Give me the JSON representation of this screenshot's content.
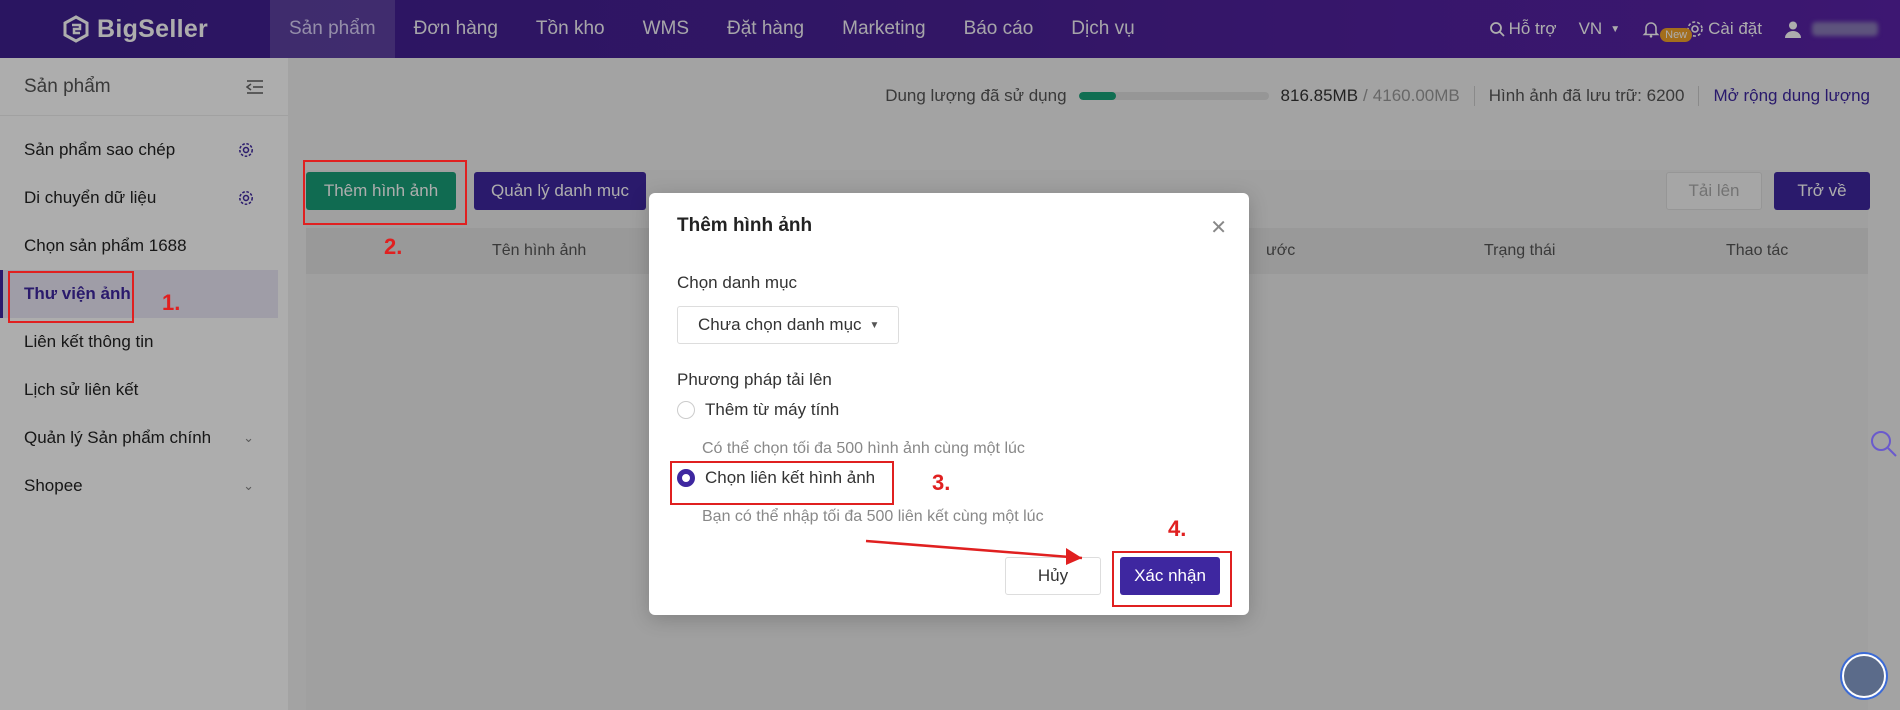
{
  "brand": {
    "name": "BigSeller"
  },
  "nav": {
    "items": [
      "Sản phẩm",
      "Đơn hàng",
      "Tồn kho",
      "WMS",
      "Đặt hàng",
      "Marketing",
      "Báo cáo",
      "Dịch vụ"
    ],
    "support": "Hỗ trợ",
    "lang": "VN",
    "new_badge": "New",
    "settings": "Cài đặt"
  },
  "sidebar": {
    "title": "Sản phẩm",
    "items": [
      {
        "label": "Sản phẩm sao chép"
      },
      {
        "label": "Di chuyển dữ liệu"
      },
      {
        "label": "Chọn sản phẩm 1688"
      },
      {
        "label": "Thư viện ảnh"
      },
      {
        "label": "Liên kết thông tin"
      },
      {
        "label": "Lịch sử liên kết"
      },
      {
        "label": "Quản lý Sản phẩm chính"
      },
      {
        "label": "Shopee"
      }
    ]
  },
  "storage": {
    "label": "Dung lượng đã sử dụng",
    "used": "816.85MB",
    "total": "4160.00MB",
    "used_fraction": 0.196,
    "images_stored": "Hình ảnh đã lưu trữ: 6200",
    "expand": "Mở rộng dung lượng"
  },
  "toolbar": {
    "add_images": "Thêm hình ảnh",
    "manage_category": "Quản lý danh mục",
    "upload": "Tải lên",
    "back": "Trở về"
  },
  "table": {
    "headers": [
      "Tên hình ảnh",
      "ước",
      "Trạng thái",
      "Thao tác"
    ]
  },
  "modal": {
    "title": "Thêm hình ảnh",
    "category_label": "Chọn danh mục",
    "category_value": "Chưa chọn danh mục",
    "method_label": "Phương pháp tải lên",
    "option_computer": "Thêm từ máy tính",
    "option_computer_hint": "Có thể chọn tối đa 500 hình ảnh cùng một lúc",
    "option_link": "Chọn liên kết hình ảnh",
    "option_link_hint": "Bạn có thể nhập tối đa 500 liên kết cùng một lúc",
    "cancel": "Hủy",
    "confirm": "Xác nhận"
  },
  "annotations": [
    "1.",
    "2.",
    "3.",
    "4."
  ],
  "colors": {
    "brand_purple": "#3e27a0",
    "green": "#199e78",
    "annotation_red": "#e02020"
  }
}
